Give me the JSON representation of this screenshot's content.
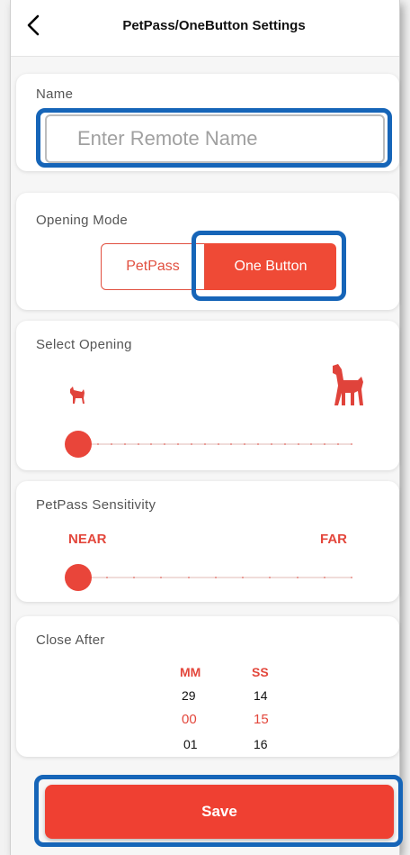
{
  "header": {
    "title": "PetPass/OneButton Settings",
    "back_icon": "chevron-left-icon"
  },
  "name_card": {
    "label": "Name",
    "placeholder": "Enter Remote Name",
    "value": ""
  },
  "opening_mode": {
    "label": "Opening Mode",
    "options": [
      "PetPass",
      "One Button"
    ],
    "selected": "One Button"
  },
  "select_opening": {
    "label": "Select Opening",
    "small_icon": "small-dog-icon",
    "large_icon": "large-dog-icon",
    "level": 0
  },
  "sensitivity": {
    "label": "PetPass Sensitivity",
    "min_label": "NEAR",
    "max_label": "FAR",
    "level": 0
  },
  "close_after": {
    "label": "Close After",
    "mm_header": "MM",
    "ss_header": "SS",
    "mm_prev": "29",
    "ss_prev": "14",
    "mm_selected": "00",
    "ss_selected": "15",
    "mm_next": "01",
    "ss_next": "16"
  },
  "save_label": "Save",
  "colors": {
    "accent": "#ef4a36",
    "highlight": "#1665b8"
  }
}
